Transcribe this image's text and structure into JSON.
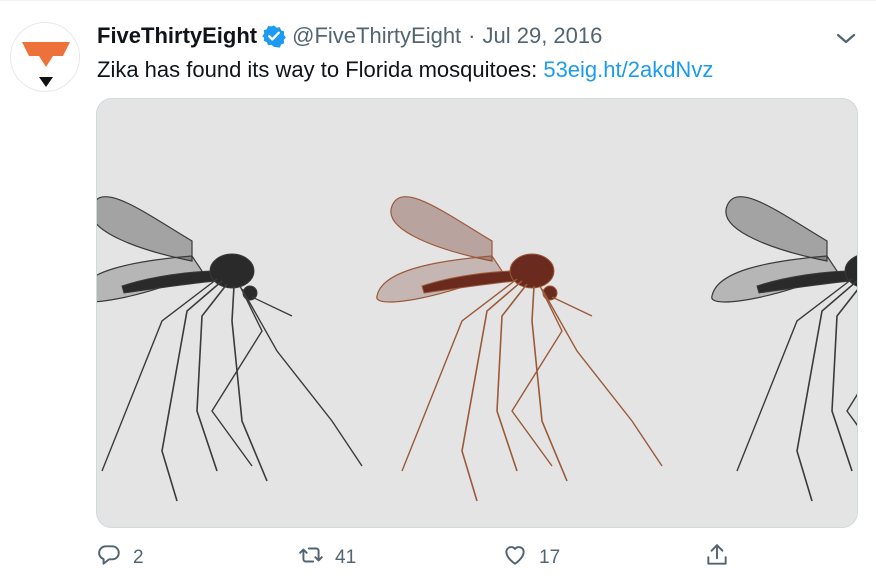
{
  "tweet": {
    "author_name": "FiveThirtyEight",
    "handle": "@FiveThirtyEight",
    "separator": "·",
    "date": "Jul 29, 2016",
    "text": "Zika has found its way to Florida mosquitoes: ",
    "link_text": "53eig.ht/2akdNvz",
    "verified": true
  },
  "actions": {
    "reply_count": "2",
    "retweet_count": "41",
    "like_count": "17"
  },
  "icons": {
    "verified": "verified-badge-icon",
    "more": "chevron-down-icon",
    "reply": "reply-icon",
    "retweet": "retweet-icon",
    "like": "heart-icon",
    "share": "share-icon"
  },
  "colors": {
    "text": "#0f1419",
    "secondary": "#536471",
    "link": "#1d9bf0",
    "brand_orange": "#ed713a",
    "media_background": "#e4e4e4"
  }
}
